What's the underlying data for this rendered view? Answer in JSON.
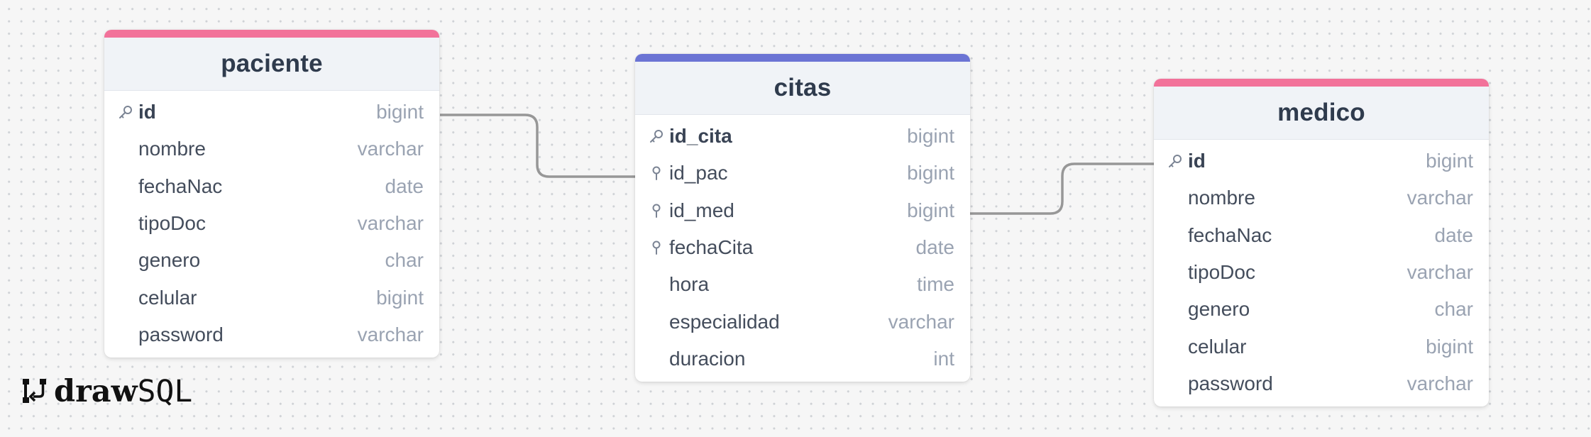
{
  "accents": {
    "pink": "#f2729a",
    "blue": "#6b74d4",
    "connector": "#979797"
  },
  "icons": {
    "primary_key": "key-icon",
    "foreign_key": "pin-icon"
  },
  "tables": {
    "paciente": {
      "title": "paciente",
      "accent": "#f2729a",
      "columns": [
        {
          "name": "id",
          "type": "bigint",
          "key": "primary"
        },
        {
          "name": "nombre",
          "type": "varchar",
          "key": ""
        },
        {
          "name": "fechaNac",
          "type": "date",
          "key": ""
        },
        {
          "name": "tipoDoc",
          "type": "varchar",
          "key": ""
        },
        {
          "name": "genero",
          "type": "char",
          "key": ""
        },
        {
          "name": "celular",
          "type": "bigint",
          "key": ""
        },
        {
          "name": "password",
          "type": "varchar",
          "key": ""
        }
      ]
    },
    "citas": {
      "title": "citas",
      "accent": "#6b74d4",
      "columns": [
        {
          "name": "id_cita",
          "type": "bigint",
          "key": "primary"
        },
        {
          "name": "id_pac",
          "type": "bigint",
          "key": "foreign"
        },
        {
          "name": "id_med",
          "type": "bigint",
          "key": "foreign"
        },
        {
          "name": "fechaCita",
          "type": "date",
          "key": "foreign"
        },
        {
          "name": "hora",
          "type": "time",
          "key": ""
        },
        {
          "name": "especialidad",
          "type": "varchar",
          "key": ""
        },
        {
          "name": "duracion",
          "type": "int",
          "key": ""
        }
      ]
    },
    "medico": {
      "title": "medico",
      "accent": "#f2729a",
      "columns": [
        {
          "name": "id",
          "type": "bigint",
          "key": "primary"
        },
        {
          "name": "nombre",
          "type": "varchar",
          "key": ""
        },
        {
          "name": "fechaNac",
          "type": "date",
          "key": ""
        },
        {
          "name": "tipoDoc",
          "type": "varchar",
          "key": ""
        },
        {
          "name": "genero",
          "type": "char",
          "key": ""
        },
        {
          "name": "celular",
          "type": "bigint",
          "key": ""
        },
        {
          "name": "password",
          "type": "varchar",
          "key": ""
        }
      ]
    }
  },
  "relations": [
    {
      "from": "paciente.id",
      "to": "citas.id_pac"
    },
    {
      "from": "citas.id_med",
      "to": "medico.id"
    }
  ],
  "logo": {
    "draw": "draw",
    "sql": "SQL"
  }
}
